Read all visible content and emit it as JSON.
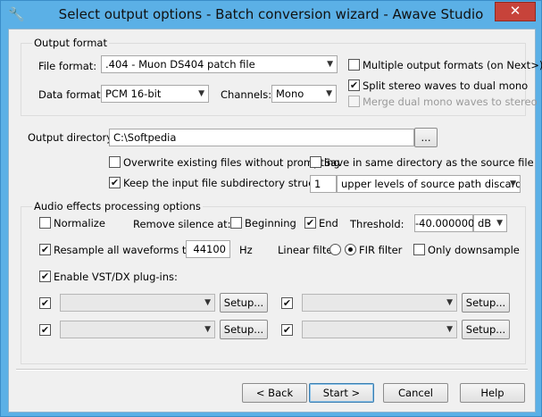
{
  "window": {
    "title": "Select output options - Batch conversion wizard - Awave Studio",
    "close_glyph": "✕",
    "app_icon": "wrench-icon"
  },
  "output_format": {
    "group_label": "Output format",
    "file_format_label": "File format:",
    "file_format_value": ".404 - Muon DS404 patch file",
    "data_format_label": "Data format:",
    "data_format_value": "PCM 16-bit",
    "channels_label": "Channels:",
    "channels_value": "Mono",
    "multiple_formats_label": "Multiple output formats (on Next>)",
    "multiple_formats_checked": false,
    "split_stereo_label": "Split stereo waves to dual mono",
    "split_stereo_checked": true,
    "merge_dual_label": "Merge dual mono waves to stereo",
    "merge_dual_checked": false
  },
  "output_directory": {
    "label": "Output directory:",
    "value": "C:\\Softpedia",
    "browse_label": "...",
    "overwrite_label": "Overwrite existing files without prompting",
    "overwrite_checked": false,
    "save_same_label": "Save in same directory as the source file",
    "save_same_checked": false,
    "keep_structure_label": "Keep the input file subdirectory structure:",
    "keep_structure_checked": true,
    "levels_value": "1",
    "levels_mode": "upper levels of source path discarded"
  },
  "effects": {
    "group_label": "Audio effects processing options",
    "normalize_label": "Normalize",
    "normalize_checked": false,
    "remove_silence_label": "Remove silence at:",
    "beginning_label": "Beginning",
    "beginning_checked": false,
    "end_label": "End",
    "end_checked": true,
    "threshold_label": "Threshold:",
    "threshold_value": "-40.000000",
    "threshold_unit": "dB",
    "resample_label": "Resample all waveforms to:",
    "resample_checked": true,
    "resample_value": "44100",
    "resample_unit": "Hz",
    "linear_filter_label": "Linear filter",
    "fir_filter_label": "FIR filter",
    "fir_selected": true,
    "only_downsample_label": "Only downsample",
    "only_downsample_checked": false,
    "vst_label": "Enable VST/DX plug-ins:",
    "vst_checked": true,
    "setup_label": "Setup...",
    "plugins": [
      {
        "checked": true,
        "value": ""
      },
      {
        "checked": true,
        "value": ""
      },
      {
        "checked": true,
        "value": ""
      },
      {
        "checked": true,
        "value": ""
      }
    ]
  },
  "footer": {
    "back_label": "< Back",
    "start_label": "Start >",
    "cancel_label": "Cancel",
    "help_label": "Help"
  },
  "check_glyph": "✔"
}
